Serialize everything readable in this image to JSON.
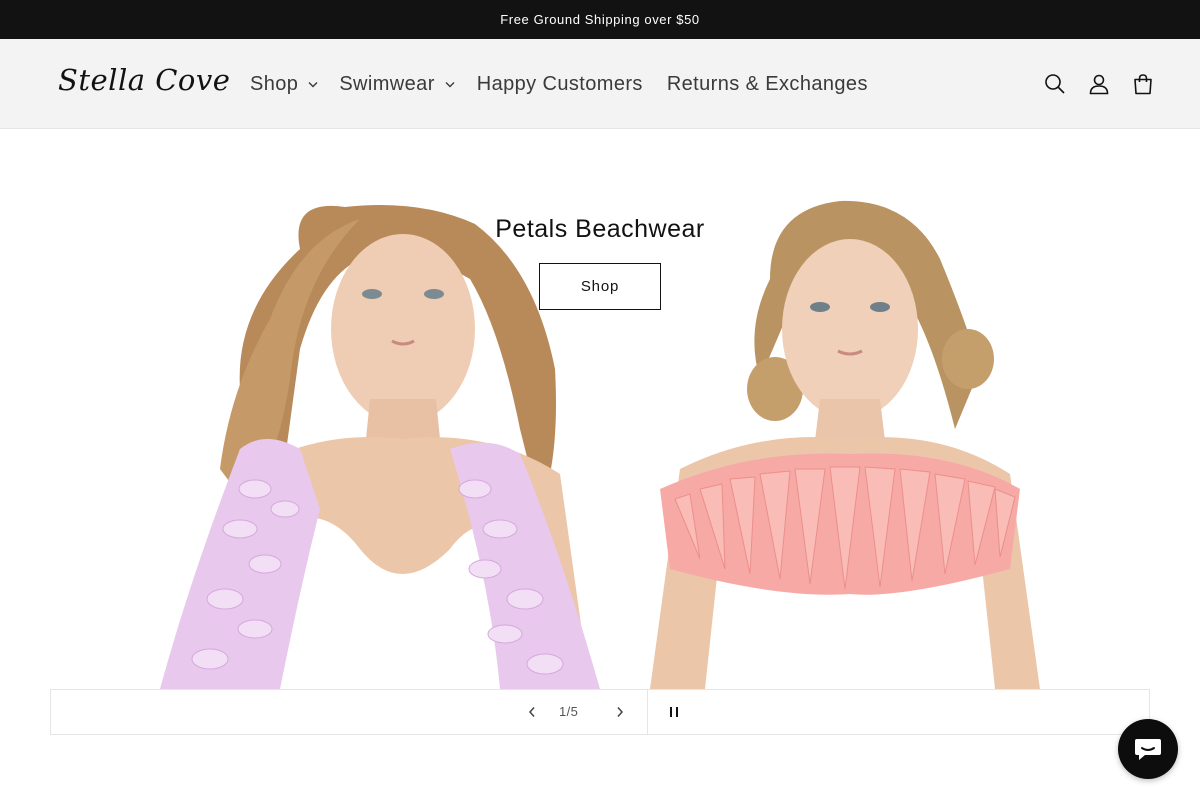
{
  "announcement": {
    "text": "Free Ground Shipping over $50"
  },
  "header": {
    "logo": "Stella Cove",
    "nav": [
      {
        "label": "Shop",
        "has_dropdown": true
      },
      {
        "label": "Swimwear",
        "has_dropdown": true
      },
      {
        "label": "Happy Customers",
        "has_dropdown": false
      },
      {
        "label": "Returns & Exchanges",
        "has_dropdown": false
      }
    ],
    "icons": [
      "search-icon",
      "account-icon",
      "cart-icon"
    ]
  },
  "hero": {
    "title": "Petals Beachwear",
    "button_label": "Shop"
  },
  "slider": {
    "counter": "1/5",
    "current": 1,
    "total": 5
  },
  "chat": {
    "icon": "chat-icon"
  },
  "colors": {
    "announcement_bg": "#121212",
    "header_bg": "#f3f3f3",
    "text": "#121212",
    "petal_lilac": "#e8c8ec",
    "petal_pink": "#f7a9a5",
    "chat_bg": "#0d0d0d"
  }
}
